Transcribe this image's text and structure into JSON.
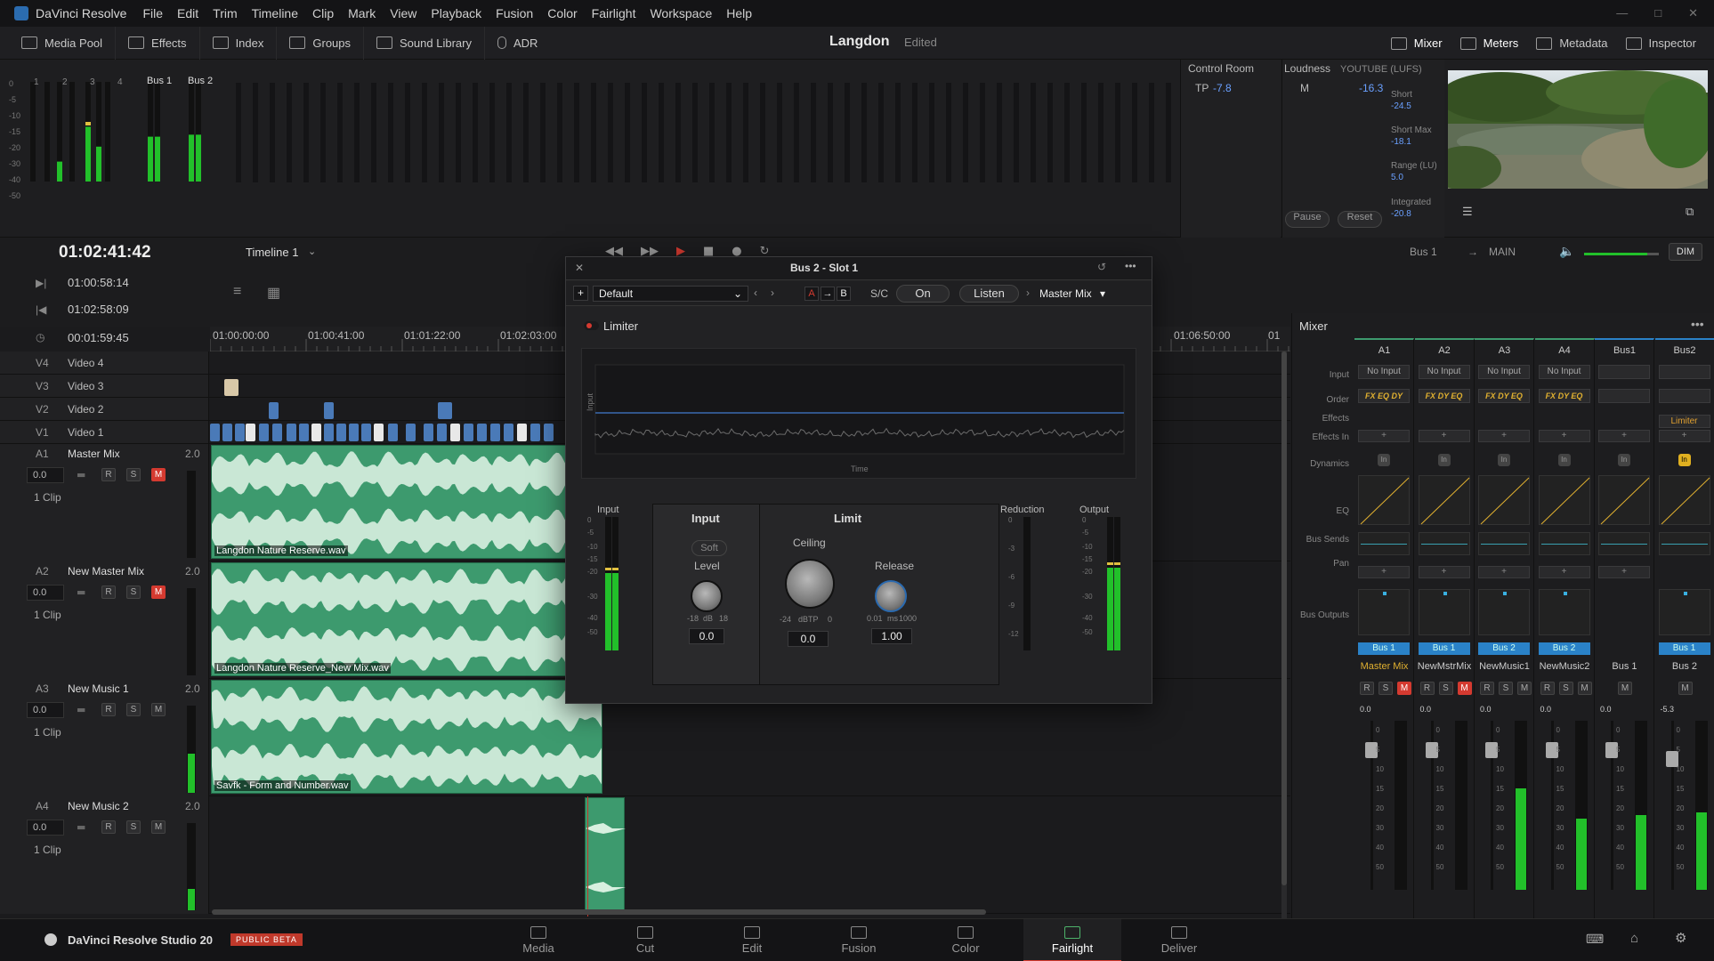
{
  "app": {
    "name": "DaVinci Resolve",
    "menu": [
      "File",
      "Edit",
      "Trim",
      "Timeline",
      "Clip",
      "Mark",
      "View",
      "Playback",
      "Fusion",
      "Color",
      "Fairlight",
      "Workspace",
      "Help"
    ]
  },
  "toolbar": {
    "left": [
      "Media Pool",
      "Effects",
      "Index",
      "Groups",
      "Sound Library",
      "ADR"
    ],
    "project": "Langdon",
    "status": "Edited",
    "right": [
      "Mixer",
      "Meters",
      "Metadata",
      "Inspector"
    ]
  },
  "meters": {
    "channels": [
      "1",
      "2",
      "3",
      "4"
    ],
    "buses": [
      "Bus 1",
      "Bus 2"
    ],
    "scale": [
      "0",
      "-5",
      "-10",
      "-15",
      "-20",
      "-30",
      "-40",
      "-50"
    ],
    "control_room": {
      "title": "Control Room",
      "tp_label": "TP",
      "tp_value": "-7.8"
    },
    "loudness": {
      "title": "Loudness",
      "standard": "YOUTUBE (LUFS)",
      "m_label": "M",
      "m_value": "-16.3",
      "scale": [
        "-14",
        "-26",
        "-38",
        "-50"
      ],
      "short_label": "Short",
      "short": "-24.5",
      "short_max_label": "Short Max",
      "short_max": "-18.1",
      "range_label": "Range (LU)",
      "range": "5.0",
      "integrated_label": "Integrated",
      "integrated": "-20.8",
      "pause": "Pause",
      "reset": "Reset"
    }
  },
  "transport": {
    "timecode": "01:02:41:42",
    "timeline": "Timeline 1",
    "in": "01:00:58:14",
    "out": "01:02:58:09",
    "duration": "00:01:59:45",
    "bus": "Bus 1",
    "main": "MAIN",
    "dim": "DIM",
    "volume": 0.85
  },
  "ruler": [
    "01:00:00:00",
    "01:00:41:00",
    "01:01:22:00",
    "01:02:03:00",
    "01:06:50:00",
    "01"
  ],
  "video_tracks": [
    {
      "id": "V4",
      "name": "Video 4"
    },
    {
      "id": "V3",
      "name": "Video 3"
    },
    {
      "id": "V2",
      "name": "Video 2"
    },
    {
      "id": "V1",
      "name": "Video 1"
    }
  ],
  "audio_tracks": [
    {
      "id": "A1",
      "name": "Master Mix",
      "ch": "2.0",
      "vol": "0.0",
      "clips": "1 Clip",
      "clip": "Langdon Nature Reserve.wav",
      "muted": true
    },
    {
      "id": "A2",
      "name": "New Master Mix",
      "ch": "2.0",
      "vol": "0.0",
      "clips": "1 Clip",
      "clip": "Langdon Nature Reserve_New Mix.wav",
      "muted": true
    },
    {
      "id": "A3",
      "name": "New Music 1",
      "ch": "2.0",
      "vol": "0.0",
      "clips": "1 Clip",
      "clip": "Savfk - Form and Number.wav",
      "muted": false
    },
    {
      "id": "A4",
      "name": "New Music 2",
      "ch": "2.0",
      "vol": "0.0",
      "clips": "1 Clip",
      "clip": "",
      "muted": false
    }
  ],
  "rsm": {
    "r": "R",
    "s": "S",
    "m": "M"
  },
  "plugin": {
    "title": "Bus 2 - Slot 1",
    "preset": "Default",
    "a": "A",
    "b": "B",
    "sc": "S/C",
    "on": "On",
    "listen": "Listen",
    "route": "Master Mix",
    "name": "Limiter",
    "graph_y": "Input",
    "graph_x": "Time",
    "input_label": "Input",
    "output_label": "Output",
    "reduction_label": "Reduction",
    "sec_input": "Input",
    "sec_limit": "Limit",
    "soft": "Soft",
    "level": "Level",
    "level_min": "-18",
    "level_unit": "dB",
    "level_max": "18",
    "level_val": "0.0",
    "ceiling": "Ceiling",
    "ceil_min": "-24",
    "ceil_unit": "dBTP",
    "ceil_max": "0",
    "ceil_val": "0.0",
    "release": "Release",
    "rel_min": "0.01",
    "rel_unit": "ms",
    "rel_max": "1000",
    "rel_val": "1.00",
    "meter_scale": [
      "0",
      "-5",
      "-10",
      "-15",
      "-20",
      "-30",
      "-40",
      "-50"
    ],
    "red_scale": [
      "0",
      "-3",
      "-6",
      "-9",
      "-12"
    ]
  },
  "mixer": {
    "title": "Mixer",
    "rows": [
      "Input",
      "Order",
      "Effects",
      "Effects In",
      "Dynamics",
      "EQ",
      "Bus Sends",
      "Pan",
      "Bus Outputs"
    ],
    "channels": [
      {
        "id": "A1",
        "input": "No Input",
        "order": "FX EQ DY",
        "out": "Bus 1",
        "name": "Master Mix",
        "gain": "0.0"
      },
      {
        "id": "A2",
        "input": "No Input",
        "order": "FX DY EQ",
        "out": "Bus 1",
        "name": "NewMstrMix",
        "gain": "0.0"
      },
      {
        "id": "A3",
        "input": "No Input",
        "order": "FX DY EQ",
        "out": "Bus 2",
        "name": "NewMusic1",
        "gain": "0.0"
      },
      {
        "id": "A4",
        "input": "No Input",
        "order": "FX DY EQ",
        "out": "Bus 2",
        "name": "NewMusic2",
        "gain": "0.0"
      },
      {
        "id": "Bus1",
        "input": "",
        "order": "",
        "out": "",
        "name": "Bus 1",
        "gain": "0.0"
      },
      {
        "id": "Bus2",
        "input": "",
        "order": "",
        "out": "Bus 1",
        "name": "Bus 2",
        "gain": "-5.3",
        "effect": "Limiter"
      }
    ],
    "fader_scale": [
      "0",
      "5",
      "10",
      "15",
      "20",
      "30",
      "40",
      "50"
    ],
    "plus": "+",
    "in_label": "In"
  },
  "pages": [
    "Media",
    "Cut",
    "Edit",
    "Fusion",
    "Color",
    "Fairlight",
    "Deliver"
  ],
  "active_page": "Fairlight",
  "brand": {
    "name": "DaVinci Resolve Studio 20",
    "badge": "PUBLIC BETA"
  },
  "colors": {
    "accent": "#d43a30",
    "clip": "#3d9a6e",
    "meter": "#22c02a",
    "bus": "#2a82c8"
  }
}
